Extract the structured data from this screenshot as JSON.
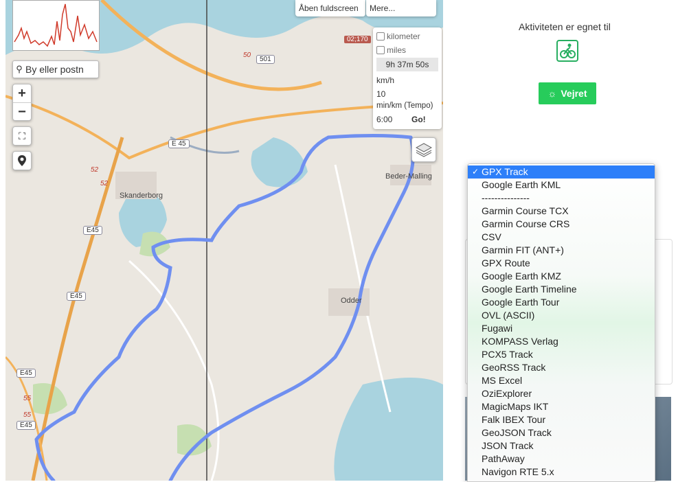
{
  "map": {
    "buttons": {
      "fullscreen": "Åben fuldscreen",
      "more": "Mere..."
    },
    "search": {
      "placeholder": "By eller postn"
    },
    "zoom": {
      "in": "+",
      "out": "−"
    },
    "settings": {
      "kilometer": "kilometer",
      "miles": "miles",
      "time": "9h 37m 50s",
      "kmh_label": "km/h",
      "kmh_value": "10",
      "tempo_label": "min/km (Tempo)",
      "tempo_value": "6:00",
      "go": "Go!"
    },
    "road_labels": {
      "e45a": "E 45",
      "e45b": "E45",
      "e45c": "E45",
      "e45d": "E45",
      "e45e": "E45",
      "r501": "501",
      "r52a": "52",
      "r52b": "52",
      "r50": "50",
      "r55a": "55",
      "r55b": "55",
      "r02": "02;170"
    },
    "place_labels": {
      "skanderborg": "Skanderborg",
      "odder": "Odder",
      "bedervalling": "Beder-Malling"
    },
    "track_color": "#6f8ff0",
    "icons": [
      "search-icon",
      "fullscreen-icon",
      "location-pin-icon",
      "layers-icon"
    ]
  },
  "sidebar": {
    "suits_label": "Aktiviteten er egnet til",
    "activity_icon": "cyclist-icon",
    "weather_button": "Vejret",
    "accent": "#27cc5b"
  },
  "format_dropdown": {
    "selected": "GPX Track",
    "options": [
      "GPX Track",
      "Google Earth KML",
      "---------------",
      "Garmin Course TCX",
      "Garmin Course CRS",
      "CSV",
      "Garmin FIT (ANT+)",
      "GPX Route",
      "Google Earth KMZ",
      "Google Earth Timeline",
      "Google Earth Tour",
      "OVL (ASCII)",
      "Fugawi",
      "KOMPASS Verlag",
      "PCX5 Track",
      "GeoRSS Track",
      "MS Excel",
      "OziExplorer",
      "MagicMaps IKT",
      "Falk IBEX Tour",
      "GeoJSON Track",
      "JSON Track",
      "PathAway",
      "Navigon RTE 5.x"
    ]
  }
}
